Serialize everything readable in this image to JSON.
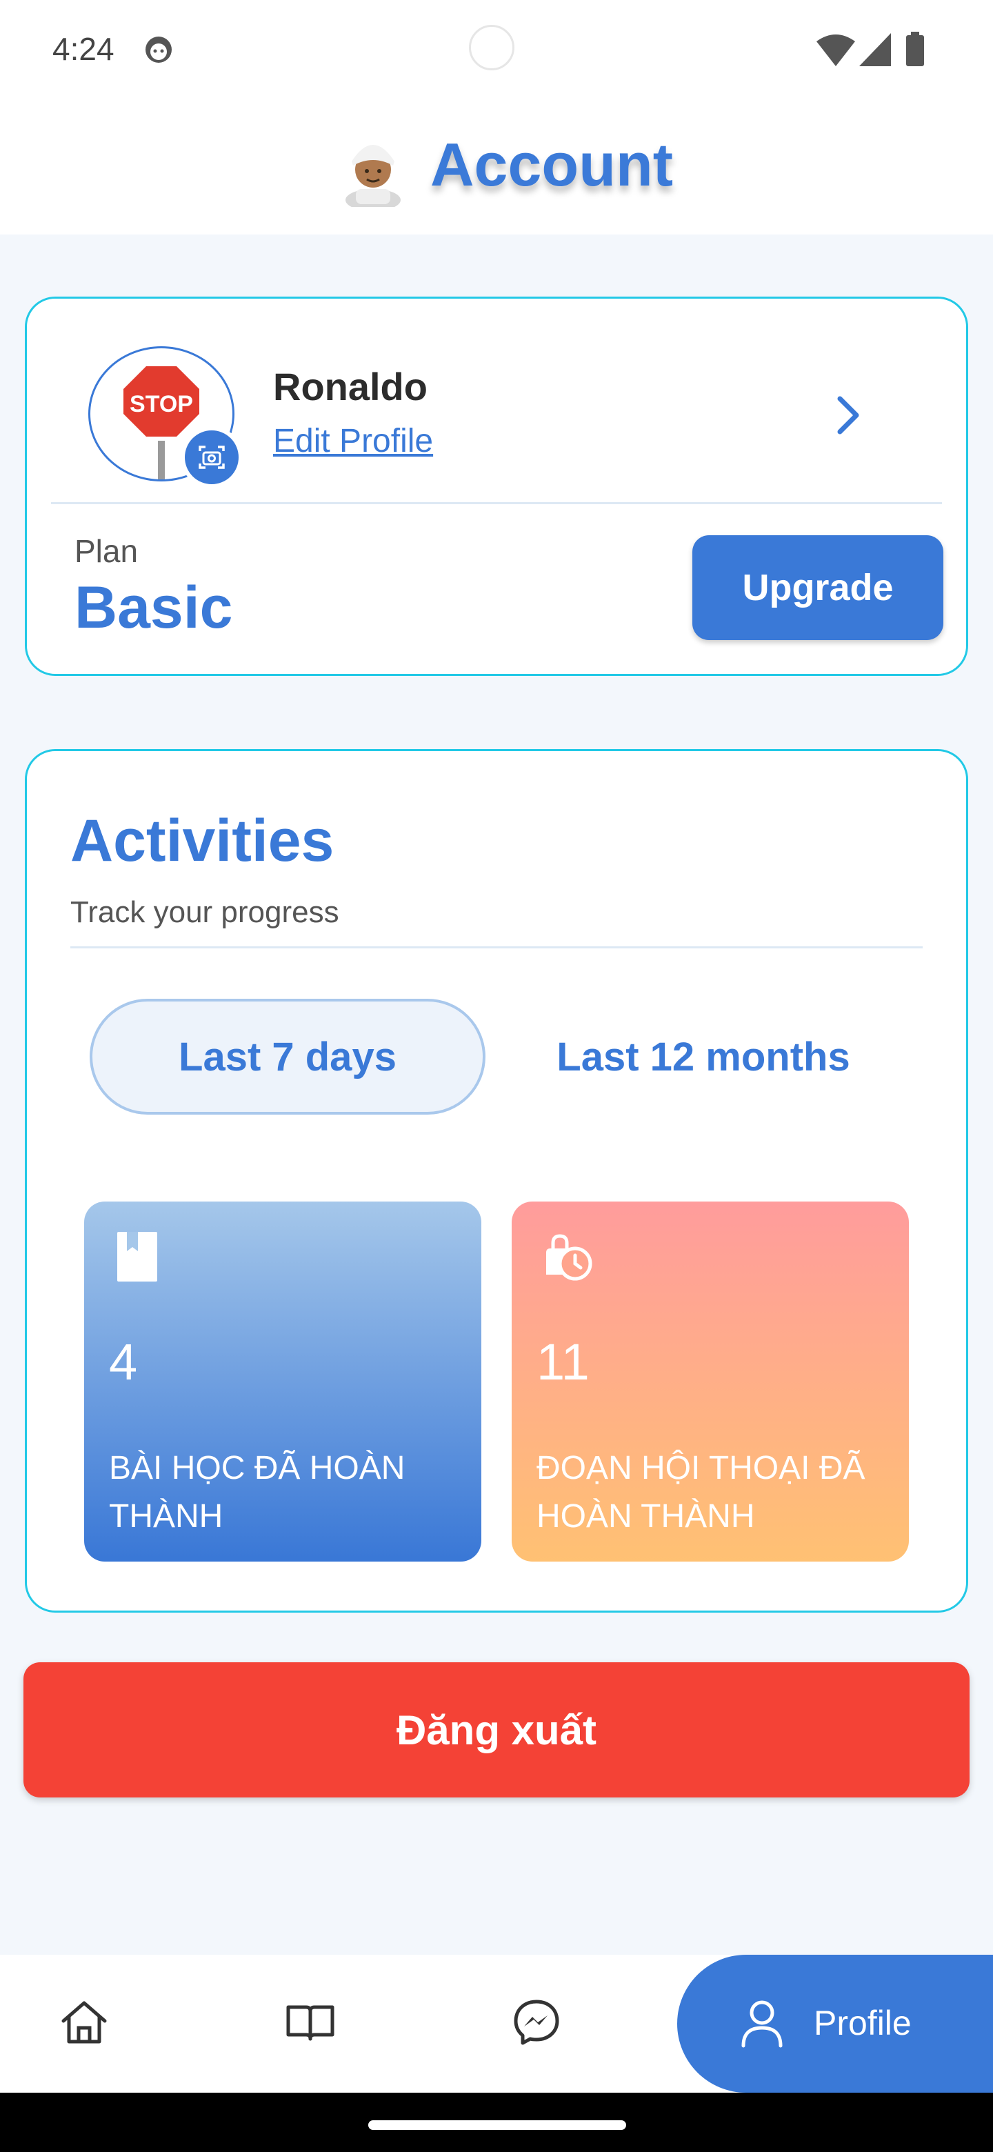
{
  "status_bar": {
    "time": "4:24"
  },
  "header": {
    "title": "Account"
  },
  "profile": {
    "name": "Ronaldo",
    "edit_label": "Edit Profile"
  },
  "plan": {
    "label": "Plan",
    "value": "Basic",
    "upgrade_label": "Upgrade"
  },
  "activities": {
    "title": "Activities",
    "subtitle": "Track your progress",
    "tabs": [
      {
        "label": "Last 7 days",
        "selected": true
      },
      {
        "label": "Last 12 months",
        "selected": false
      }
    ],
    "stats": [
      {
        "value": "4",
        "label": "Bài học đã hoàn thành",
        "icon": "book-icon"
      },
      {
        "value": "11",
        "label": "Đoạn hội thoại đã hoàn thành",
        "icon": "timer-bag-icon"
      }
    ]
  },
  "logout_label": "Đăng xuất",
  "bottom_nav": {
    "items": [
      {
        "icon": "home-icon"
      },
      {
        "icon": "open-book-icon"
      },
      {
        "icon": "messenger-icon"
      },
      {
        "icon": "user-icon",
        "label": "Profile",
        "active": true
      }
    ]
  },
  "colors": {
    "accent": "#3a79d7",
    "card_border": "#22c9e6",
    "logout": "#f44236"
  }
}
